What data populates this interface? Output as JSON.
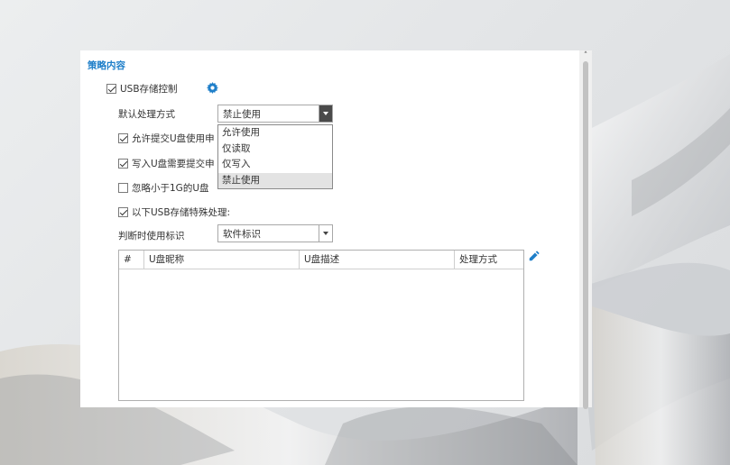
{
  "section": {
    "title": "策略内容"
  },
  "usb_control": {
    "label": "USB存储控制",
    "checked": true,
    "settings_icon": "gear-icon"
  },
  "default_action": {
    "label": "默认处理方式",
    "selected": "禁止使用",
    "options": [
      "允许使用",
      "仅读取",
      "仅写入",
      "禁止使用"
    ]
  },
  "options": {
    "allow_submit": {
      "label": "允许提交U盘使用申",
      "checked": true
    },
    "write_requires": {
      "label": "写入U盘需要提交申",
      "checked": true
    },
    "ignore_small": {
      "label": "忽略小于1G的U盘",
      "checked": false
    },
    "special_usb": {
      "label": "以下USB存储特殊处理:",
      "checked": true
    }
  },
  "identify": {
    "label": "判断时使用标识",
    "selected": "软件标识"
  },
  "table": {
    "columns": [
      "#",
      "U盘昵称",
      "U盘描述",
      "处理方式"
    ],
    "rows": []
  },
  "icons": {
    "edit": "pencil-icon",
    "settings": "gear-icon",
    "scroll_up": "chevron-up-icon"
  },
  "colors": {
    "accent": "#1f7fc9"
  }
}
